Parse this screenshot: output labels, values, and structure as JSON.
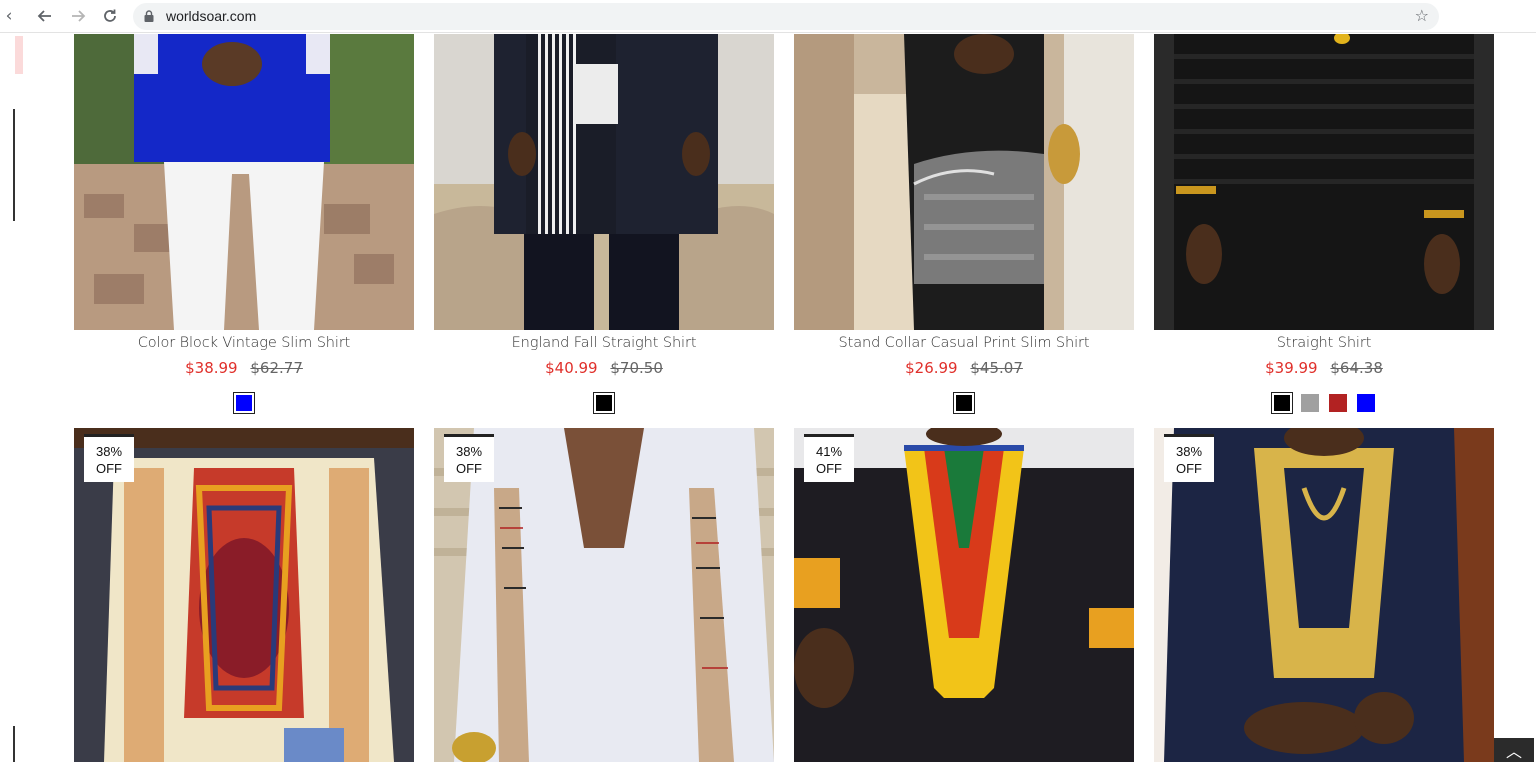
{
  "browser": {
    "url": "worldsoar.com",
    "back_icon": "arrow-left",
    "forward_icon": "arrow-right",
    "reload_icon": "reload",
    "bookmark_icon": "star"
  },
  "products_row1": [
    {
      "name": "Color Block Vintage Slim Shirt",
      "price": "$38.99",
      "old_price": "$62.77",
      "swatches": [
        "#0000ff"
      ]
    },
    {
      "name": "England Fall Straight Shirt",
      "price": "$40.99",
      "old_price": "$70.50",
      "swatches": [
        "#000000"
      ]
    },
    {
      "name": "Stand Collar Casual Print Slim Shirt",
      "price": "$26.99",
      "old_price": "$45.07",
      "swatches": [
        "#000000"
      ]
    },
    {
      "name": "Straight Shirt",
      "price": "$39.99",
      "old_price": "$64.38",
      "swatches": [
        "#000000",
        "#a0a0a0",
        "#b22222",
        "#0000ff"
      ]
    }
  ],
  "products_row2": [
    {
      "badge_pct": "38%",
      "badge_off": "OFF"
    },
    {
      "badge_pct": "38%",
      "badge_off": "OFF"
    },
    {
      "badge_pct": "41%",
      "badge_off": "OFF"
    },
    {
      "badge_pct": "38%",
      "badge_off": "OFF"
    }
  ],
  "colors": {
    "sale_price": "#e0302b",
    "old_price": "#666666"
  }
}
